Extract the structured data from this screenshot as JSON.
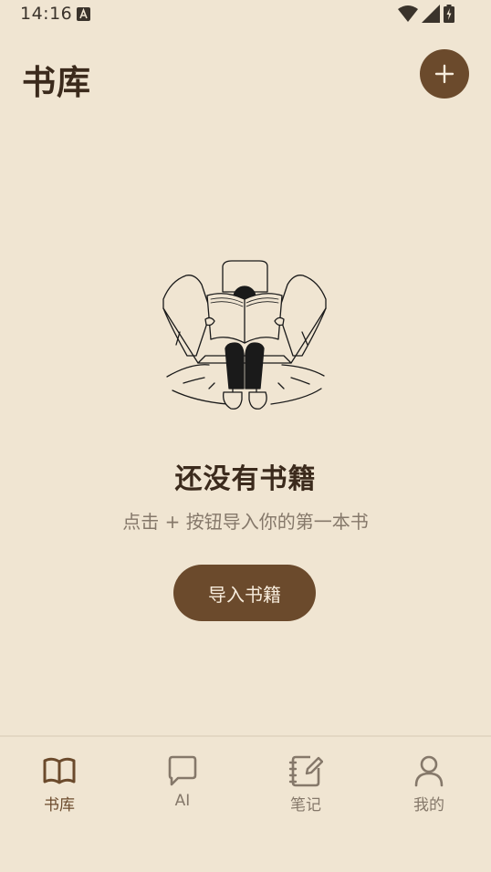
{
  "status_bar": {
    "time": "14:16",
    "icons": [
      "a-notification-icon",
      "wifi-icon",
      "signal-icon",
      "battery-charging-icon"
    ]
  },
  "header": {
    "title": "书库",
    "add_button_icon": "plus-icon"
  },
  "empty_state": {
    "illustration": "person-reading-book-icon",
    "title": "还没有书籍",
    "subtitle": "点击 + 按钮导入你的第一本书",
    "button_label": "导入书籍"
  },
  "bottom_nav": {
    "items": [
      {
        "label": "书库",
        "icon": "book-open-icon",
        "active": true
      },
      {
        "label": "AI",
        "icon": "chat-bubble-icon",
        "active": false
      },
      {
        "label": "笔记",
        "icon": "notebook-edit-icon",
        "active": false
      },
      {
        "label": "我的",
        "icon": "user-icon",
        "active": false
      }
    ]
  },
  "colors": {
    "background": "#f0e5d2",
    "accent": "#6b4a2c",
    "title": "#3b2a1c",
    "muted": "#85786a"
  }
}
